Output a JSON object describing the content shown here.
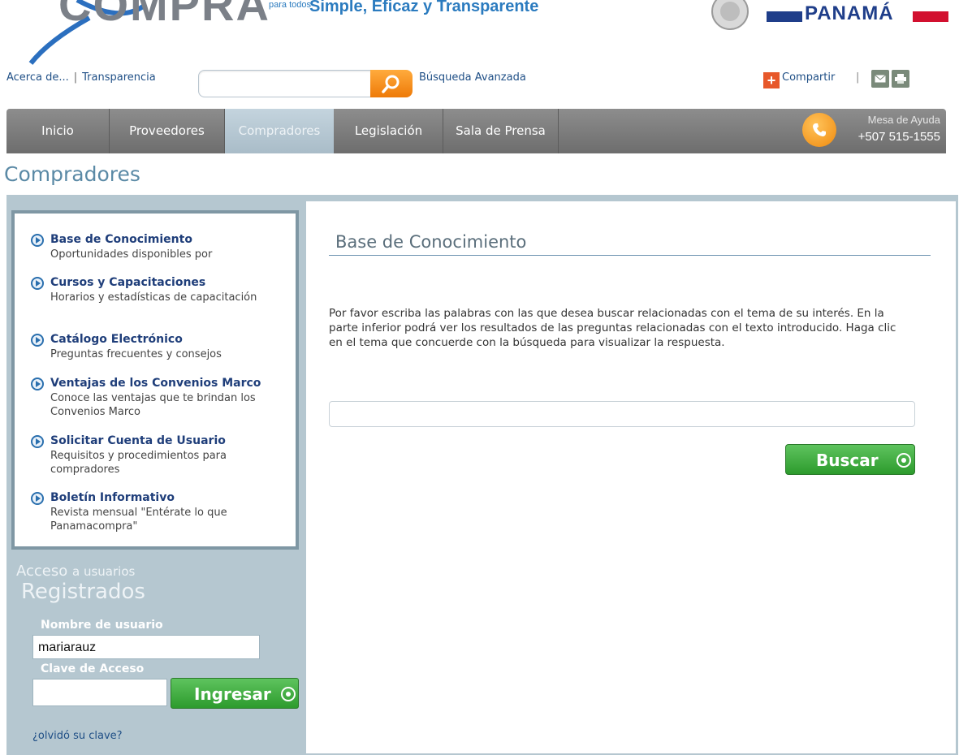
{
  "header": {
    "logo_text": "COMPRA",
    "slogan_small": "para todos",
    "slogan_main": "Simple, Eficaz y Transparente",
    "country": "PANAMÁ"
  },
  "toplinks": {
    "about": "Acerca de...",
    "separator": "|",
    "transparency": "Transparencia",
    "search_placeholder": "",
    "advanced_search": "Búsqueda Avanzada",
    "share": "Compartir",
    "share_sep": "|"
  },
  "nav": {
    "items": [
      "Inicio",
      "Proveedores",
      "Compradores",
      "Legislación",
      "Sala de Prensa"
    ],
    "active": "Compradores",
    "help_title": "Mesa de Ayuda",
    "help_phone": "+507 515-1555"
  },
  "page": {
    "title": "Compradores"
  },
  "sidebar": {
    "items": [
      {
        "title": "Base de Conocimiento",
        "desc": "Oportunidades disponibles por"
      },
      {
        "title": "Cursos y Capacitaciones",
        "desc": "Horarios y estadísticas de capacitación"
      },
      {
        "title": "Catálogo Electrónico",
        "desc": "Preguntas frecuentes y consejos"
      },
      {
        "title": "Ventajas de los Convenios Marco",
        "desc": "Conoce las ventajas que te brindan los Convenios Marco"
      },
      {
        "title": "Solicitar Cuenta de Usuario",
        "desc": "Requisitos y procedimientos para compradores"
      },
      {
        "title": "Boletín Informativo",
        "desc": "Revista mensual \"Entérate lo que Panamacompra\""
      }
    ]
  },
  "login": {
    "acceso": "Acceso",
    "a_usuarios": "a usuarios",
    "registrados": "Registrados",
    "user_label": "Nombre de usuario",
    "user_value": "mariarauz",
    "pass_label": "Clave de Acceso",
    "button": "Ingresar",
    "forgot": "¿olvidó su clave?"
  },
  "main": {
    "title": "Base de Conocimiento",
    "instructions": "Por favor escriba las palabras con las que desea buscar relacionadas con el tema de su interés. En la parte inferior podrá ver los resultados de las preguntas relacionadas con el texto introducido. Haga clic en el tema que concuerde con la búsqueda para visualizar la respuesta.",
    "query_value": "",
    "search_button": "Buscar"
  },
  "colors": {
    "brand_blue": "#1f3e8a",
    "accent_orange": "#ee7a08",
    "button_green": "#2d9b2d",
    "frame_blue_gray": "#b5c7d0"
  },
  "icons": {
    "search": "magnifier-icon",
    "share": "plus-icon",
    "mail": "envelope-icon",
    "print": "printer-icon",
    "help": "phone-icon",
    "bullet": "circle-arrow-icon"
  }
}
